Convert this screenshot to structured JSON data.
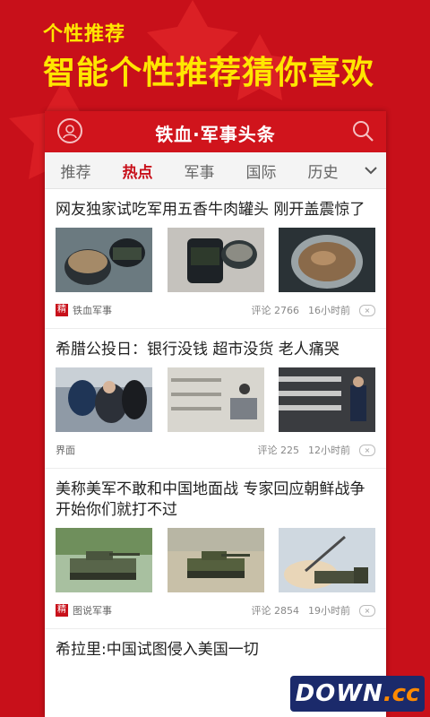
{
  "promo": {
    "subtitle": "个性推荐",
    "headline": "智能个性推荐猜你喜欢"
  },
  "app": {
    "title": "铁血·军事头条",
    "user_icon": "user-icon",
    "search_icon": "search-icon"
  },
  "tabs": [
    {
      "label": "推荐",
      "active": false
    },
    {
      "label": "热点",
      "active": true
    },
    {
      "label": "军事",
      "active": false
    },
    {
      "label": "国际",
      "active": false
    },
    {
      "label": "历史",
      "active": false
    }
  ],
  "articles": [
    {
      "title": "网友独家试吃军用五香牛肉罐头 刚开盖震惊了",
      "source_badge": "精",
      "source": "铁血军事",
      "comments": "评论 2766",
      "time": "16小时前",
      "images": [
        "canned-beef-photo",
        "canned-beef-label-photo",
        "open-can-photo"
      ]
    },
    {
      "title": "希腊公投日：银行没钱 超市没货 老人痛哭",
      "source_badge": "",
      "source": "界面",
      "comments": "评论 225",
      "time": "12小时前",
      "images": [
        "crying-elderly-photo",
        "empty-shelves-photo",
        "empty-supermarket-photo"
      ]
    },
    {
      "title": "美称美军不敢和中国地面战 专家回应朝鲜战争开始你们就打不过",
      "source_badge": "精",
      "source": "图说军事",
      "comments": "评论 2854",
      "time": "19小时前",
      "images": [
        "armored-vehicle-photo",
        "tank-exercise-photo",
        "rocket-launcher-photo"
      ]
    },
    {
      "title": "希拉里:中国试图侵入美国一切"
    }
  ],
  "dismiss_label": "×",
  "watermark": {
    "main": "DOWN",
    "suffix": ".cc"
  },
  "colors": {
    "brand_red": "#c8101a",
    "promo_yellow": "#ffe600",
    "watermark_blue": "#1b2a6b"
  }
}
